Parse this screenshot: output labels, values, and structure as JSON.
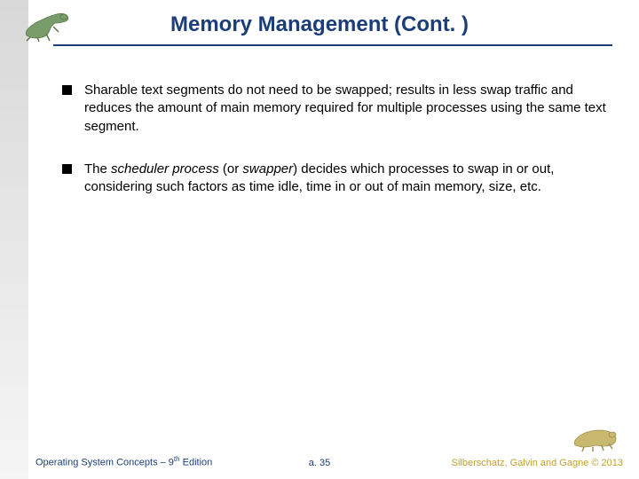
{
  "title": "Memory Management (Cont. )",
  "bullets": [
    {
      "plain": "Sharable text segments do not need to be swapped; results in less swap traffic and reduces the amount of main memory required for multiple processes using the same text segment."
    },
    {
      "html": "The <i>scheduler process</i> (or <i>swapper</i>) decides which processes to swap in or out, considering such factors as time idle, time in or out of main memory, size, etc."
    }
  ],
  "footer": {
    "left_prefix": "Operating System Concepts – 9",
    "left_sup": "th",
    "left_suffix": " Edition",
    "center": "a. 35",
    "right": "Silberschatz, Galvin and Gagne © 2013"
  },
  "icons": {
    "top_logo": "dinosaur-running",
    "bottom_logo": "dinosaur-standing"
  }
}
